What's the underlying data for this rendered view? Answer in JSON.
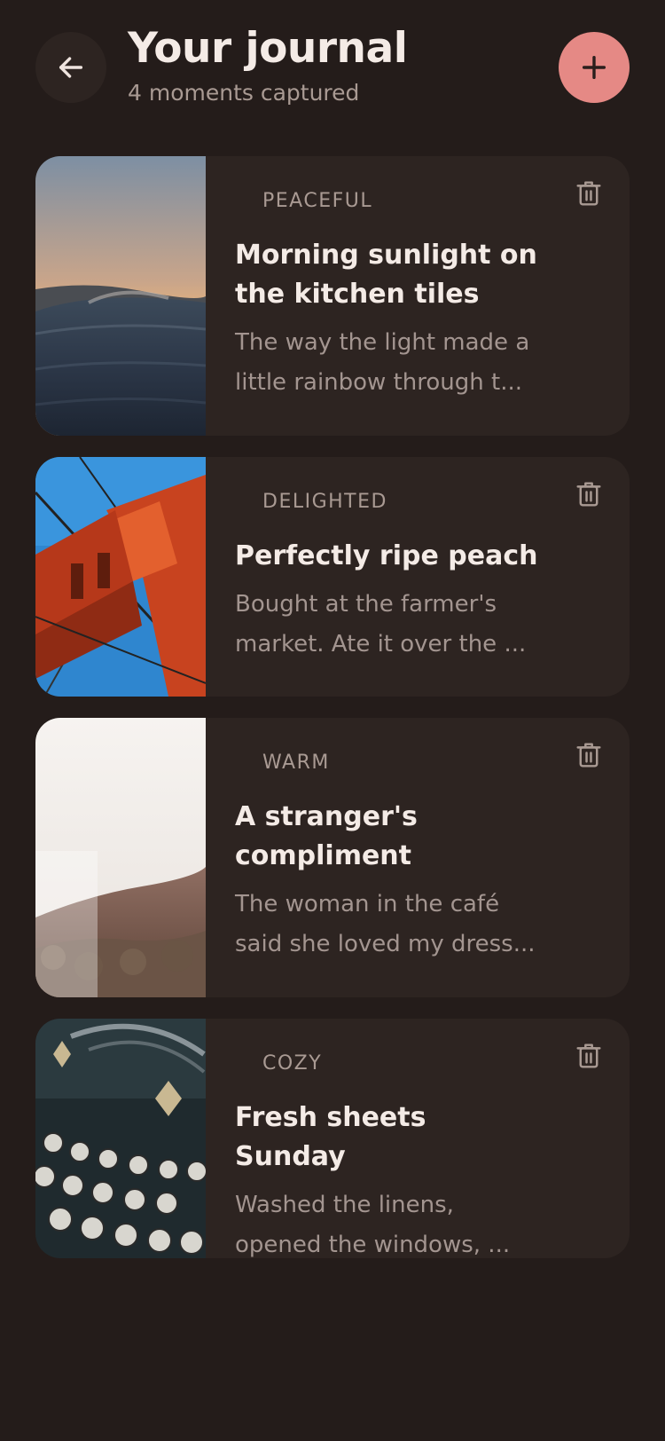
{
  "header": {
    "title": "Your journal",
    "subtitle": "4 moments captured"
  },
  "icons": {
    "back": "arrow-left-icon",
    "add": "plus-icon",
    "delete": "trash-icon"
  },
  "colors": {
    "background": "#241c1a",
    "card": "#2d2421",
    "accent": "#e58985"
  },
  "entries": [
    {
      "mood": "PEACEFUL",
      "title": "Morning sunlight on the kitchen tiles",
      "excerpt": "The way the light made a little rainbow through t...",
      "image": "ocean-wave-sunset-photo"
    },
    {
      "mood": "DELIGHTED",
      "title": "Perfectly ripe peach",
      "excerpt": "Bought at the farmer's market. Ate it over the ...",
      "image": "golden-gate-bridge-photo"
    },
    {
      "mood": "WARM",
      "title": "A stranger's compliment",
      "excerpt": "The woman in the café said she loved my dress...",
      "image": "hollywood-hills-photo"
    },
    {
      "mood": "COZY",
      "title": "Fresh sheets Sunday",
      "excerpt": "Washed the linens, opened the windows, ...",
      "image": "vintage-typewriter-photo"
    }
  ]
}
